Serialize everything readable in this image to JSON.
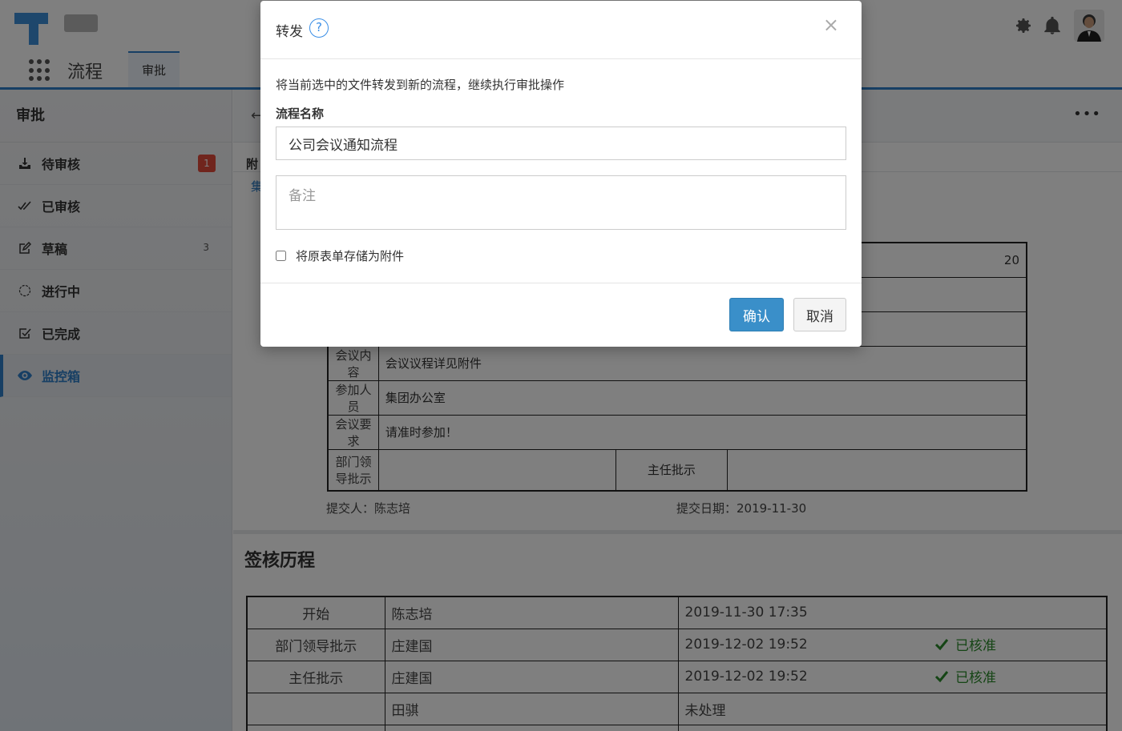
{
  "header": {
    "module_title": "流程",
    "active_tab": "审批"
  },
  "sidebar": {
    "title": "审批",
    "items": [
      {
        "label": "待审核",
        "icon": "inbox-download-icon",
        "badge": "1"
      },
      {
        "label": "已审核",
        "icon": "double-check-icon"
      },
      {
        "label": "草稿",
        "icon": "edit-icon",
        "count": "3"
      },
      {
        "label": "进行中",
        "icon": "loading-circle-icon"
      },
      {
        "label": "已完成",
        "icon": "checkbox-checked-icon"
      },
      {
        "label": "监控箱",
        "icon": "eye-icon",
        "active": true
      }
    ]
  },
  "main": {
    "attach_label": "附",
    "attach_sub": "集",
    "form_rows": [
      {
        "label": "会议内容",
        "value": "会议议程详见附件"
      },
      {
        "label": "参加人员",
        "value": "集团办公室"
      },
      {
        "label": "会议要求",
        "value": "请准时参加！"
      }
    ],
    "partial_date": "20",
    "dept_approval_label": "部门领导批示",
    "director_approval_label": "主任批示",
    "submitter": "提交人：陈志培",
    "submit_date": "提交日期：2019-11-30",
    "history_title": "签核历程",
    "history": [
      {
        "step": "开始",
        "person": "陈志培",
        "time": "2019-11-30 17:35",
        "result": ""
      },
      {
        "step": "部门领导批示",
        "person": "庄建国",
        "time": "2019-12-02 19:52",
        "result": "已核准"
      },
      {
        "step": "主任批示",
        "person": "庄建国",
        "time": "2019-12-02 19:52",
        "result": "已核准"
      },
      {
        "step": "",
        "person": "田骐",
        "time": "未处理",
        "result": ""
      }
    ]
  },
  "modal": {
    "title": "转发",
    "help_symbol": "?",
    "close_symbol": "×",
    "description": "将当前选中的文件转发到新的流程，继续执行审批操作",
    "field_label": "流程名称",
    "name_value": "公司会议通知流程",
    "remark_placeholder": "备注",
    "checkbox_label": "将原表单存储为附件",
    "checkbox_checked": false,
    "confirm_label": "确认",
    "cancel_label": "取消"
  },
  "colors": {
    "accent": "#2f7fc9",
    "badge": "#e04a3b",
    "approved": "#2a8a2a",
    "pending": "#d2322d",
    "confirm_button": "#3a8fc9"
  }
}
